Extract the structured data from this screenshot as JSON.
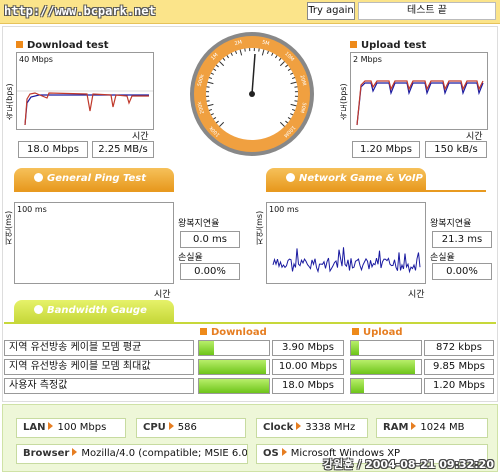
{
  "header": {
    "url": "http://www.bcpark.net",
    "try_again": "Try again",
    "test_end": "테스트 끝"
  },
  "download": {
    "title": "Download test",
    "scale": "40 Mbps",
    "ylabel": "속도(bps)",
    "xlabel": "시간",
    "mbps": "18.0 Mbps",
    "mbs": "2.25 MB/s"
  },
  "upload": {
    "title": "Upload test",
    "scale": "2 Mbps",
    "ylabel": "속도(bps)",
    "xlabel": "시간",
    "mbps": "1.20 Mbps",
    "kbs": "150 kB/s"
  },
  "gauge": {
    "labels": [
      "100k",
      "200k",
      "500k",
      "1M",
      "2M",
      "5M",
      "10M",
      "20M",
      "50M",
      "100M"
    ]
  },
  "ping": {
    "banner": "General Ping Test",
    "scale": "100 ms",
    "ylabel": "지연(ms)",
    "xlabel": "시간",
    "rtt_label": "왕복지연율",
    "rtt": "0.0 ms",
    "loss_label": "손실율",
    "loss": "0.00%"
  },
  "voip": {
    "banner": "Network Game & VoIP Test",
    "scale": "100 ms",
    "ylabel": "지연(ms)",
    "xlabel": "시간",
    "rtt_label": "왕복지연율",
    "rtt": "21.3 ms",
    "loss_label": "손실율",
    "loss": "0.00%"
  },
  "bandwidth": {
    "banner": "Bandwidth Gauge",
    "download_header": "Download",
    "upload_header": "Upload",
    "rows": [
      {
        "label": "지역 유선방송 케이블 모뎀 평균",
        "down": "3.90 Mbps",
        "down_frac": 0.22,
        "up": "872 kbps",
        "up_frac": 0.11
      },
      {
        "label": "지역 유선방송 케이블 모뎀 최대값",
        "down": "10.00 Mbps",
        "down_frac": 0.95,
        "up": "9.85 Mbps",
        "up_frac": 0.92
      },
      {
        "label": "사용자 측정값",
        "down": "18.0 Mbps",
        "down_frac": 1.0,
        "up": "1.20 Mbps",
        "up_frac": 0.18
      }
    ]
  },
  "system": {
    "lan_label": "LAN",
    "lan": "100 Mbps",
    "cpu_label": "CPU",
    "cpu": "586",
    "clock_label": "Clock",
    "clock": "3338 MHz",
    "ram_label": "RAM",
    "ram": "1024 MB",
    "browser_label": "Browser",
    "browser": "Mozilla/4.0 (compatible; MSIE 6.0",
    "os_label": "OS",
    "os": "Microsoft Windows XP"
  },
  "signature": "강원훈 / 2004-08-21 09:32:20",
  "colors": {
    "accent": "#ee8a1a",
    "bar_fill": "#7cc52a",
    "graph_blue": "#1a1aa0",
    "graph_red": "#c0392b"
  }
}
